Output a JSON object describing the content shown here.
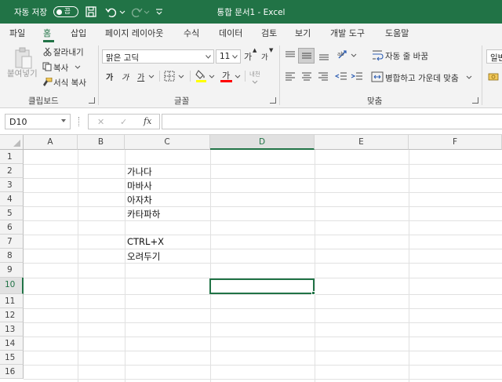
{
  "titlebar": {
    "autosave_label": "자동 저장",
    "autosave_toggle": "끔",
    "doc_title": "통합 문서1  -  Excel"
  },
  "tabs": [
    "파일",
    "홈",
    "삽입",
    "페이지 레이아웃",
    "수식",
    "데이터",
    "검토",
    "보기",
    "개발 도구",
    "도움말"
  ],
  "active_tab": "홈",
  "ribbon": {
    "clipboard": {
      "paste": "붙여넣기",
      "cut": "잘라내기",
      "copy": "복사",
      "format_painter": "서식 복사",
      "group": "클립보드"
    },
    "font": {
      "font_name": "맑은 고딕",
      "font_size": "11",
      "grow": "가",
      "shrink": "가",
      "bold": "가",
      "italic": "가",
      "underline": "가",
      "font_color": "가",
      "phonetic": "내천",
      "group": "글꼴",
      "fill_color": "#ffff00",
      "text_color": "#ff0000"
    },
    "align": {
      "wrap": "자동 줄 바꿈",
      "merge": "병합하고 가운데 맞춤",
      "group": "맞춤"
    },
    "number": {
      "format": "일반"
    }
  },
  "formula_bar": {
    "name_box": "D10",
    "cancel": "✕",
    "enter": "✓",
    "fx": "fx",
    "formula": ""
  },
  "grid": {
    "columns": [
      "A",
      "B",
      "C",
      "D",
      "E",
      "F"
    ],
    "rows": [
      "1",
      "2",
      "3",
      "4",
      "5",
      "6",
      "7",
      "8",
      "9",
      "10",
      "11",
      "12",
      "13",
      "14",
      "15",
      "16"
    ],
    "cells": {
      "C2": "가나다",
      "C3": "마바사",
      "C4": "아자차",
      "C5": "카타파하",
      "C7": "CTRL+X",
      "C8": "오려두기"
    },
    "selected_cell": "D10"
  },
  "colors": {
    "excel_green": "#217346"
  }
}
